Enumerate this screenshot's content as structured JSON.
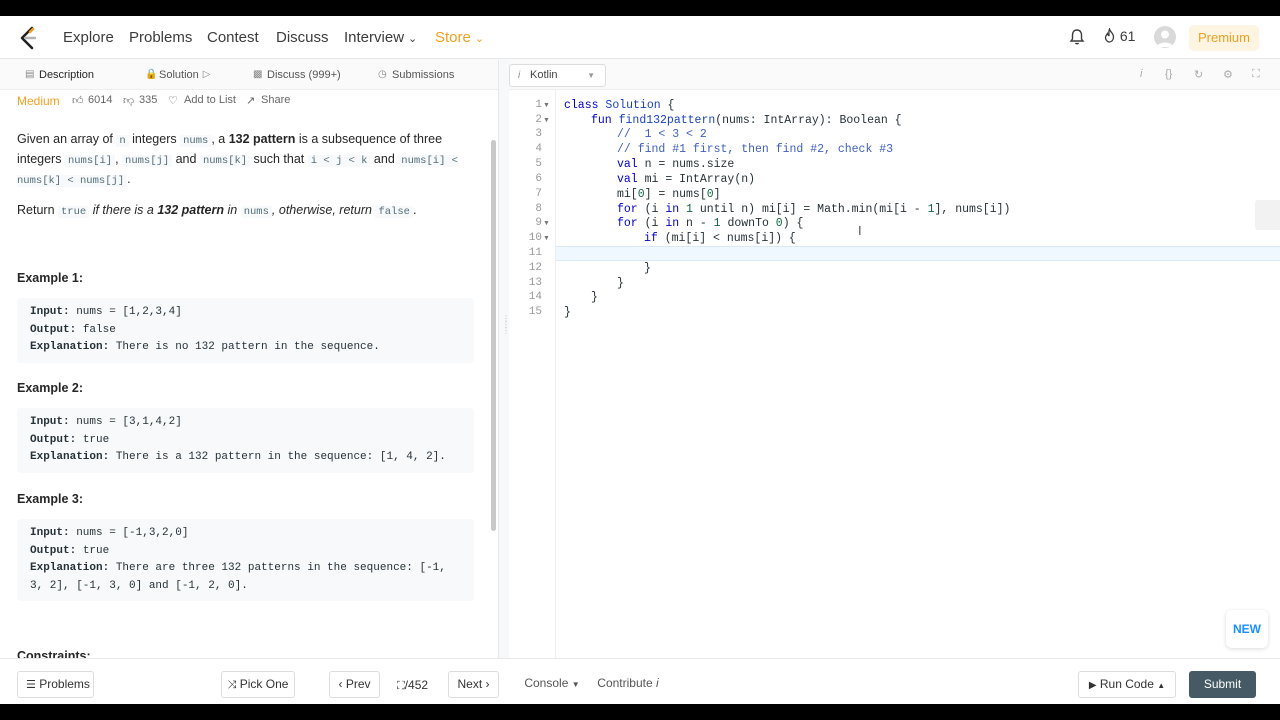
{
  "nav": {
    "links": [
      "Explore",
      "Problems",
      "Contest",
      "Discuss",
      "Interview",
      "Store"
    ],
    "streak_count": "61",
    "premium_label": "Premium"
  },
  "tabs": {
    "description": "Description",
    "solution": "Solution",
    "discuss": "Discuss (999+)",
    "submissions": "Submissions"
  },
  "problem": {
    "difficulty": "Medium",
    "likes": "6014",
    "dislikes": "335",
    "add_to_list": "Add to List",
    "share": "Share",
    "para1": {
      "t1": "Given an array of ",
      "c1": "n",
      "t2": " integers ",
      "c2": "nums",
      "t3": ", a ",
      "b1": "132 pattern",
      "t4": " is a subsequence of three integers ",
      "c3": "nums[i]",
      "t5": ", ",
      "c4": "nums[j]",
      "t6": " and ",
      "c5": "nums[k]",
      "t7": " such that ",
      "c6": "i < j < k",
      "t8": " and ",
      "c7": "nums[i] < nums[k] < nums[j]",
      "t9": "."
    },
    "para2": {
      "t1": "Return ",
      "c1": "true",
      "i1": " if there is a ",
      "b1": "132 pattern",
      "i2": " in ",
      "c2": "nums",
      "i3": ", otherwise, return ",
      "c3": "false",
      "t2": "."
    },
    "examples": [
      {
        "title": "Example 1:",
        "input_label": "Input:",
        "input": " nums = [1,2,3,4]",
        "output_label": "Output:",
        "output": " false",
        "explanation_label": "Explanation:",
        "explanation": " There is no 132 pattern in the sequence."
      },
      {
        "title": "Example 2:",
        "input_label": "Input:",
        "input": " nums = [3,1,4,2]",
        "output_label": "Output:",
        "output": " true",
        "explanation_label": "Explanation:",
        "explanation": " There is a 132 pattern in the sequence: [1, 4, 2]."
      },
      {
        "title": "Example 3:",
        "input_label": "Input:",
        "input": " nums = [-1,3,2,0]",
        "output_label": "Output:",
        "output": " true",
        "explanation_label": "Explanation:",
        "explanation": " There are three 132 patterns in the sequence: [-1,",
        "explanation_cont": "3, 2], [-1, 3, 0] and [-1, 2, 0]."
      }
    ],
    "constraints_title": "Constraints:"
  },
  "editor": {
    "language": "Kotlin",
    "line_numbers": [
      "1",
      "2",
      "3",
      "4",
      "5",
      "6",
      "7",
      "8",
      "9",
      "10",
      "11",
      "12",
      "13",
      "14",
      "15"
    ],
    "active_line": 11
  },
  "bottom": {
    "problems": "Problems",
    "pick_one": "Pick One",
    "prev": "Prev",
    "counter": "/452",
    "next": "Next",
    "console": "Console",
    "contribute": "Contribute",
    "run_code": "Run Code",
    "submit": "Submit"
  },
  "badge_new": "NEW",
  "colors": {
    "accent_orange": "#f0a020",
    "submit_bg": "#455a64",
    "keyword_blue": "#0000cc",
    "comment_blue": "#3f5fbf"
  }
}
